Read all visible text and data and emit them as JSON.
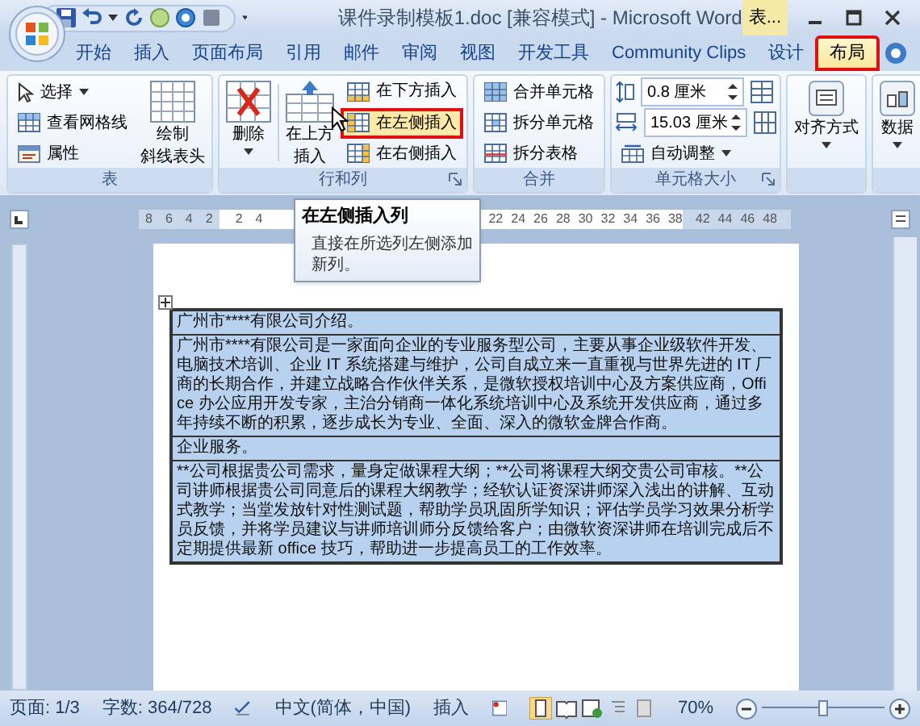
{
  "window": {
    "title": "课件录制模板1.doc [兼容模式] - Microsoft Word",
    "contextual_label": "表..."
  },
  "tabs": [
    {
      "label": "开始",
      "selected": false,
      "annotated": false
    },
    {
      "label": "插入",
      "selected": false,
      "annotated": false
    },
    {
      "label": "页面布局",
      "selected": false,
      "annotated": false
    },
    {
      "label": "引用",
      "selected": false,
      "annotated": false
    },
    {
      "label": "邮件",
      "selected": false,
      "annotated": false
    },
    {
      "label": "审阅",
      "selected": false,
      "annotated": false
    },
    {
      "label": "视图",
      "selected": false,
      "annotated": false
    },
    {
      "label": "开发工具",
      "selected": false,
      "annotated": false
    },
    {
      "label": "Community Clips",
      "selected": false,
      "annotated": false
    },
    {
      "label": "设计",
      "selected": false,
      "annotated": false
    },
    {
      "label": "布局",
      "selected": true,
      "annotated": true
    }
  ],
  "ribbon": {
    "groups": [
      {
        "label": "表",
        "columns": [
          [
            {
              "kind": "small",
              "label": "选择",
              "dropdown": true,
              "annotated": false
            },
            {
              "kind": "small",
              "label": "查看网格线",
              "annotated": false
            },
            {
              "kind": "small",
              "label": "属性",
              "annotated": false
            }
          ],
          [
            {
              "kind": "large",
              "lines": [
                "绘制",
                "斜线表头"
              ]
            }
          ]
        ]
      },
      {
        "label": "行和列",
        "launcher": true,
        "columns": [
          [
            {
              "kind": "large",
              "lines": [
                "删除"
              ],
              "dropdown": true
            }
          ],
          [
            {
              "kind": "large",
              "lines": [
                "在上方",
                "插入"
              ]
            }
          ],
          [
            {
              "kind": "small",
              "label": "在下方插入",
              "annotated": false
            },
            {
              "kind": "small",
              "label": "在左侧插入",
              "annotated": true
            },
            {
              "kind": "small",
              "label": "在右侧插入",
              "annotated": false
            }
          ]
        ]
      },
      {
        "label": "合并",
        "columns": [
          [
            {
              "kind": "small",
              "label": "合并单元格",
              "annotated": false
            },
            {
              "kind": "small",
              "label": "拆分单元格",
              "annotated": false
            },
            {
              "kind": "small",
              "label": "拆分表格",
              "annotated": false
            }
          ]
        ]
      },
      {
        "label": "单元格大小",
        "launcher": true,
        "columns": [
          [
            {
              "kind": "spin",
              "value": "0.8 厘米"
            },
            {
              "kind": "spin",
              "value": "15.03 厘米"
            },
            {
              "kind": "small",
              "label": "自动调整",
              "dropdown": true,
              "annotated": false
            }
          ]
        ]
      },
      {
        "columns": [
          [
            {
              "kind": "large",
              "lines": [
                "对齐方式"
              ],
              "dropdown": true
            }
          ]
        ]
      },
      {
        "columns": [
          [
            {
              "kind": "large",
              "lines": [
                "数据"
              ],
              "dropdown": true
            }
          ]
        ]
      }
    ]
  },
  "tooltip": {
    "title": "在左侧插入列",
    "description": "直接在所选列左侧添加新列。"
  },
  "ruler": {
    "left_numbers": [
      "8",
      "6",
      "4",
      "2"
    ],
    "right_numbers": [
      "2",
      "4"
    ],
    "far_numbers": [
      "22",
      "24",
      "26",
      "28",
      "30",
      "32",
      "34",
      "36",
      "38"
    ],
    "end_numbers": [
      "42",
      "44",
      "46",
      "48"
    ]
  },
  "table": {
    "rows": [
      {
        "text": "广州市****有限公司介绍。"
      },
      {
        "text": "广州市****有限公司是一家面向企业的专业服务型公司，主要从事企业级软件开发、电脑技术培训、企业 IT 系统搭建与维护，公司自成立来一直重视与世界先进的 IT 厂商的长期合作，并建立战略合作伙伴关系，是微软授权培训中心及方案供应商，Office 办公应用开发专家，主治分销商一体化系统培训中心及系统开发供应商，通过多年持续不断的积累，逐步成长为专业、全面、深入的微软金牌合作商。"
      },
      {
        "text": "企业服务。"
      },
      {
        "text": "**公司根据贵公司需求，量身定做课程大纲；**公司将课程大纲交贵公司审核。**公司讲师根据贵公司同意后的课程大纲教学；经软认证资深讲师深入浅出的讲解、互动式教学；当堂发放针对性测试题，帮助学员巩固所学知识；评估学员学习效果分析学员反馈，并将学员建议与讲师培训师分反馈给客户；由微软资深讲师在培训完成后不定期提供最新 office 技巧，帮助进一步提高员工的工作效率。"
      }
    ]
  },
  "status_bar": {
    "page": "页面: 1/3",
    "words": "字数: 364/728",
    "language": "中文(简体，中国)",
    "mode": "插入",
    "zoom": "70%",
    "zoom_slider": {
      "level": 0.5
    }
  }
}
